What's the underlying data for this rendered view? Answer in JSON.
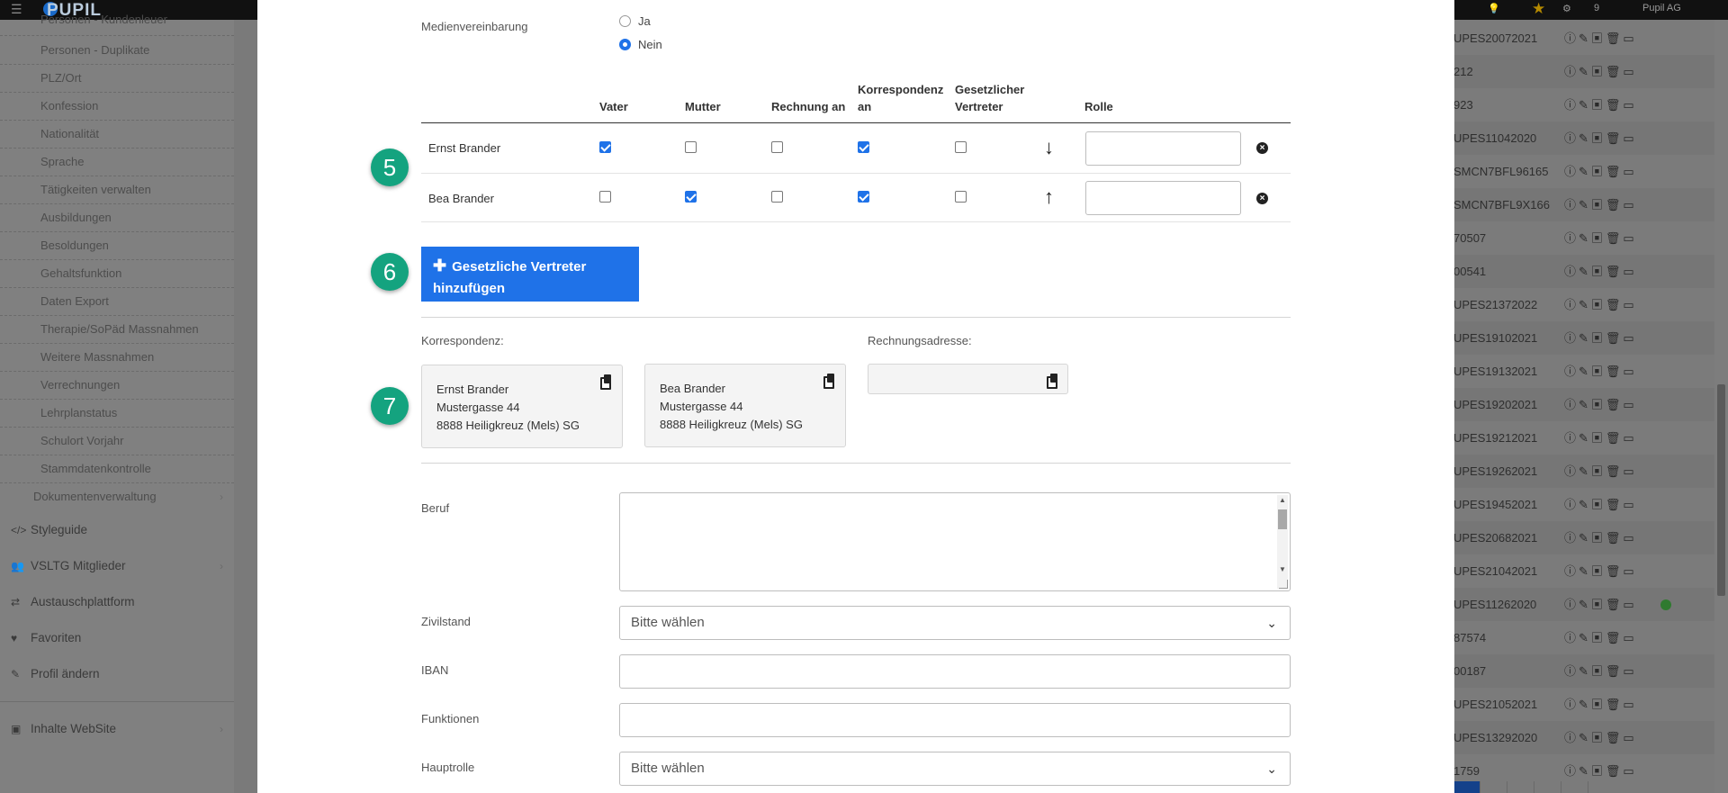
{
  "topbar": {
    "logo": "PUPIL",
    "menu_icon": "hamburger-icon",
    "notif_count": "9",
    "user": "Pupil AG"
  },
  "sidebar": {
    "sub_items": [
      "Personen - Kundenleuer",
      "Personen - Duplikate",
      "PLZ/Ort",
      "Konfession",
      "Nationalität",
      "Sprache",
      "Tätigkeiten verwalten",
      "Ausbildungen",
      "Besoldungen",
      "Gehaltsfunktion",
      "Daten Export",
      "Therapie/SoPäd Massnahmen",
      "Weitere Massnahmen",
      "Verrechnungen",
      "Lehrplanstatus",
      "Schulort Vorjahr",
      "Stammdatenkontrolle",
      "Dokumentenverwaltung"
    ],
    "main_items": [
      {
        "label": "Styleguide",
        "icon": "code-icon"
      },
      {
        "label": "VSLTG Mitglieder",
        "icon": "users-icon"
      },
      {
        "label": "Austauschplattform",
        "icon": "exchange-icon"
      },
      {
        "label": "Favoriten",
        "icon": "heart-icon"
      },
      {
        "label": "Profil ändern",
        "icon": "pencil-icon"
      },
      {
        "label": "Inhalte WebSite",
        "icon": "briefcase-icon"
      }
    ]
  },
  "bg_table": {
    "codes": [
      "UPES20072021",
      "212",
      "923",
      "UPES11042020",
      "SMCN7BFL96165",
      "SMCN7BFL9X166",
      "70507",
      "00541",
      "UPES21372022",
      "UPES19102021",
      "UPES19132021",
      "UPES19202021",
      "UPES19212021",
      "UPES19262021",
      "UPES19452021",
      "UPES20682021",
      "UPES21042021",
      "UPES11262020",
      "87574",
      "00187",
      "UPES21052021",
      "UPES13292020",
      "1759"
    ]
  },
  "modal": {
    "media": {
      "label": "Medienvereinbarung",
      "options": [
        {
          "label": "Ja",
          "checked": false
        },
        {
          "label": "Nein",
          "checked": true
        }
      ]
    },
    "table": {
      "headers": {
        "vater": "Vater",
        "mutter": "Mutter",
        "rechnung": "Rechnung an",
        "korr_1": "Korrespondenz",
        "korr_2": "an",
        "gesetz_1": "Gesetzlicher",
        "gesetz_2": "Vertreter",
        "rolle": "Rolle"
      },
      "rows": [
        {
          "name": "Ernst Brander",
          "vater": true,
          "mutter": false,
          "rechnung": false,
          "korrespondenz": true,
          "gesetzlich": false,
          "arrow": "arrow-down-icon",
          "rolle": ""
        },
        {
          "name": "Bea Brander",
          "vater": false,
          "mutter": true,
          "rechnung": false,
          "korrespondenz": true,
          "gesetzlich": false,
          "arrow": "arrow-up-icon",
          "rolle": ""
        }
      ]
    },
    "badges": {
      "b5": "5",
      "b6": "6",
      "b7": "7"
    },
    "add_button": {
      "line1": "Gesetzliche Vertreter",
      "line2": "hinzufügen",
      "icon": "plus-icon"
    },
    "korrespondenz": {
      "label": "Korrespondenz:",
      "addresses": [
        {
          "name": "Ernst Brander",
          "street": "Mustergasse 44",
          "city": "8888 Heiligkreuz (Mels) SG"
        },
        {
          "name": "Bea Brander",
          "street": "Mustergasse 44",
          "city": "8888 Heiligkreuz (Mels) SG"
        }
      ]
    },
    "rechnung": {
      "label": "Rechnungsadresse:",
      "value": ""
    },
    "form": {
      "beruf": {
        "label": "Beruf",
        "value": ""
      },
      "zivilstand": {
        "label": "Zivilstand",
        "value": "Bitte wählen"
      },
      "iban": {
        "label": "IBAN",
        "value": ""
      },
      "funktionen": {
        "label": "Funktionen",
        "value": ""
      },
      "hauptrolle": {
        "label": "Hauptrolle",
        "value": "Bitte wählen"
      }
    }
  }
}
